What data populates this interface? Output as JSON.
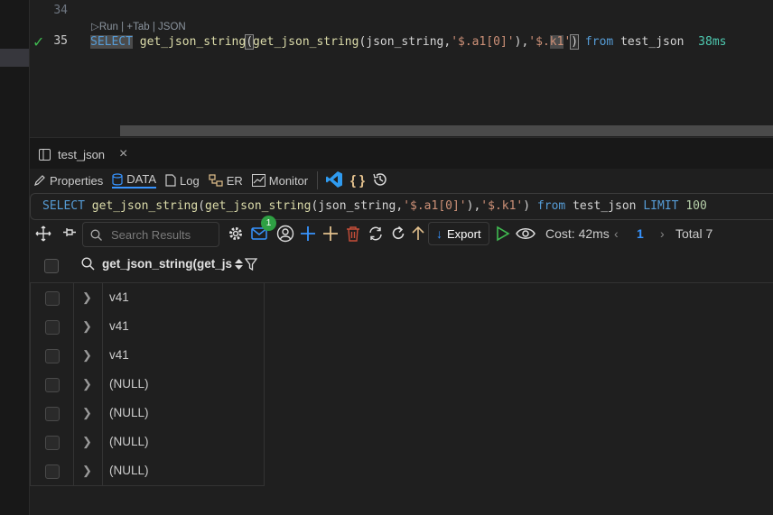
{
  "editor": {
    "line_numbers": [
      "34",
      "35"
    ],
    "codelens": {
      "run": "Run",
      "sep1": "|",
      "tab": "Tab",
      "sep2": "|",
      "json": "JSON"
    },
    "code_parts": {
      "select": "SELECT",
      "fn1": "get_json_string",
      "fn2": "get_json_string",
      "arg": "json_string",
      "str1": "'$.a1[0]'",
      "str2a": "'$.",
      "str2b": "k1",
      "str2c": "'",
      "from": "from",
      "table": "test_json",
      "exec_time": "38ms"
    }
  },
  "tab": {
    "label": "test_json",
    "close": "×"
  },
  "toolbar1": {
    "properties": "Properties",
    "data": "DATA",
    "log": "Log",
    "er": "ER",
    "monitor": "Monitor",
    "json_icon": "{ }"
  },
  "sql_preview": {
    "select": "SELECT",
    "fn1": "get_json_string",
    "fn2": "get_json_string",
    "arg": "json_string",
    "str1": "'$.a1[0]'",
    "str2": "'$.k1'",
    "from": "from",
    "table": "test_json",
    "limit": "LIMIT",
    "limit_value": "100"
  },
  "toolbar2": {
    "search_placeholder": "Search Results",
    "badge_count": "1",
    "export_label": "Export",
    "cost": "Cost: 42ms",
    "page": "1",
    "total": "Total 7"
  },
  "grid": {
    "column_header": "get_json_string(get_js",
    "rows": [
      "v41",
      "v41",
      "v41",
      "(NULL)",
      "(NULL)",
      "(NULL)",
      "(NULL)"
    ]
  },
  "colors": {
    "background": "#1f1f1f",
    "keyword": "#569cd6",
    "function": "#dcdcaa",
    "string": "#ce9178",
    "accent_green": "#3fb950",
    "accent_blue": "#3794ff",
    "vscode_blue": "#2f9bf0",
    "json_yellow": "#e2c08d"
  }
}
